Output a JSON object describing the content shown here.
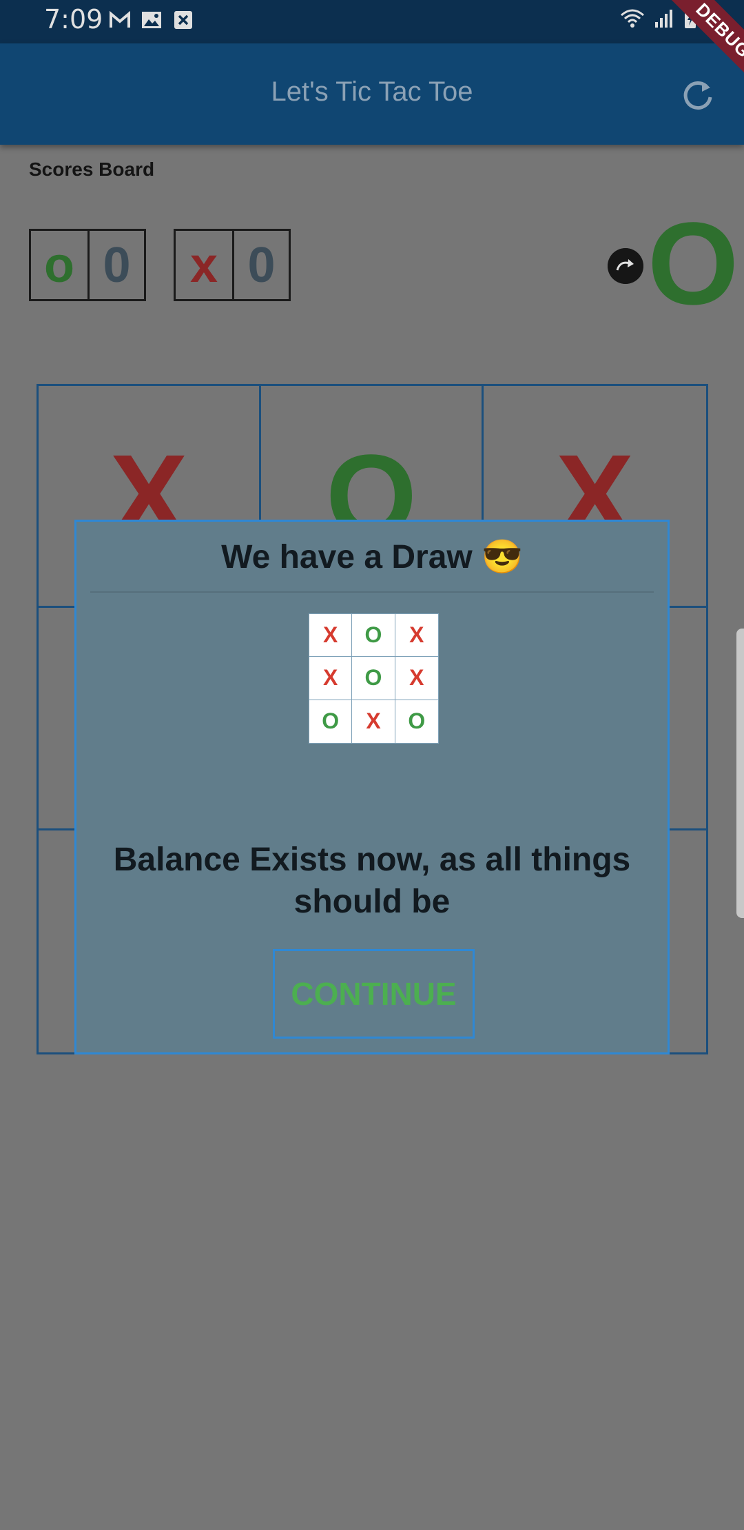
{
  "status_bar": {
    "time": "7:09",
    "left_icons": [
      "gmail-icon",
      "image-icon",
      "close-box-icon"
    ],
    "right_icons": [
      "wifi-icon",
      "signal-icon",
      "battery-charging-icon"
    ]
  },
  "debug_banner": "DEBUG",
  "app_bar": {
    "title": "Let's Tic Tac Toe",
    "action_icon": "refresh-icon"
  },
  "scores": {
    "title": "Scores Board",
    "o": {
      "mark": "o",
      "score": "0"
    },
    "x": {
      "mark": "x",
      "score": "0"
    },
    "turn_icon": "redo-icon",
    "current_turn": "O"
  },
  "board": {
    "cells": [
      "X",
      "O",
      "X",
      "",
      "",
      "",
      "",
      "",
      ""
    ]
  },
  "dialog": {
    "title": "We have a Draw 😎",
    "mini_board": [
      "X",
      "O",
      "X",
      "X",
      "O",
      "X",
      "O",
      "X",
      "O"
    ],
    "message": "Balance Exists now, as all things should be",
    "button_label": "CONTINUE"
  },
  "colors": {
    "app_bar": "#104672",
    "x_mark": "#8b2626",
    "o_mark": "#2e6f2e",
    "dialog_bg": "#617d8b",
    "dialog_border": "#2f88d4",
    "continue_text": "#4caf50"
  }
}
